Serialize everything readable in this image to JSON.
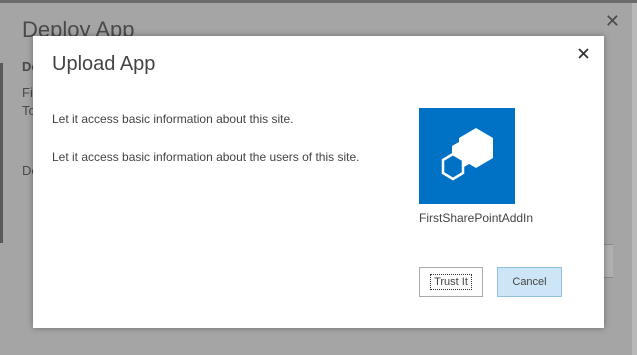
{
  "background_dialog": {
    "title": "Deploy App",
    "close_glyph": "✕",
    "labels": [
      "De",
      "Fi",
      "To",
      "De"
    ]
  },
  "dialog": {
    "title": "Upload App",
    "close_glyph": "✕",
    "permissions": [
      "Let it access basic information about this site.",
      "Let it access basic information about the users of this site."
    ],
    "app": {
      "name": "FirstSharePointAddIn",
      "icon": "sharepoint-addin-icon",
      "tile_color": "#0072c6"
    },
    "buttons": {
      "trust": "Trust It",
      "cancel": "Cancel"
    }
  }
}
